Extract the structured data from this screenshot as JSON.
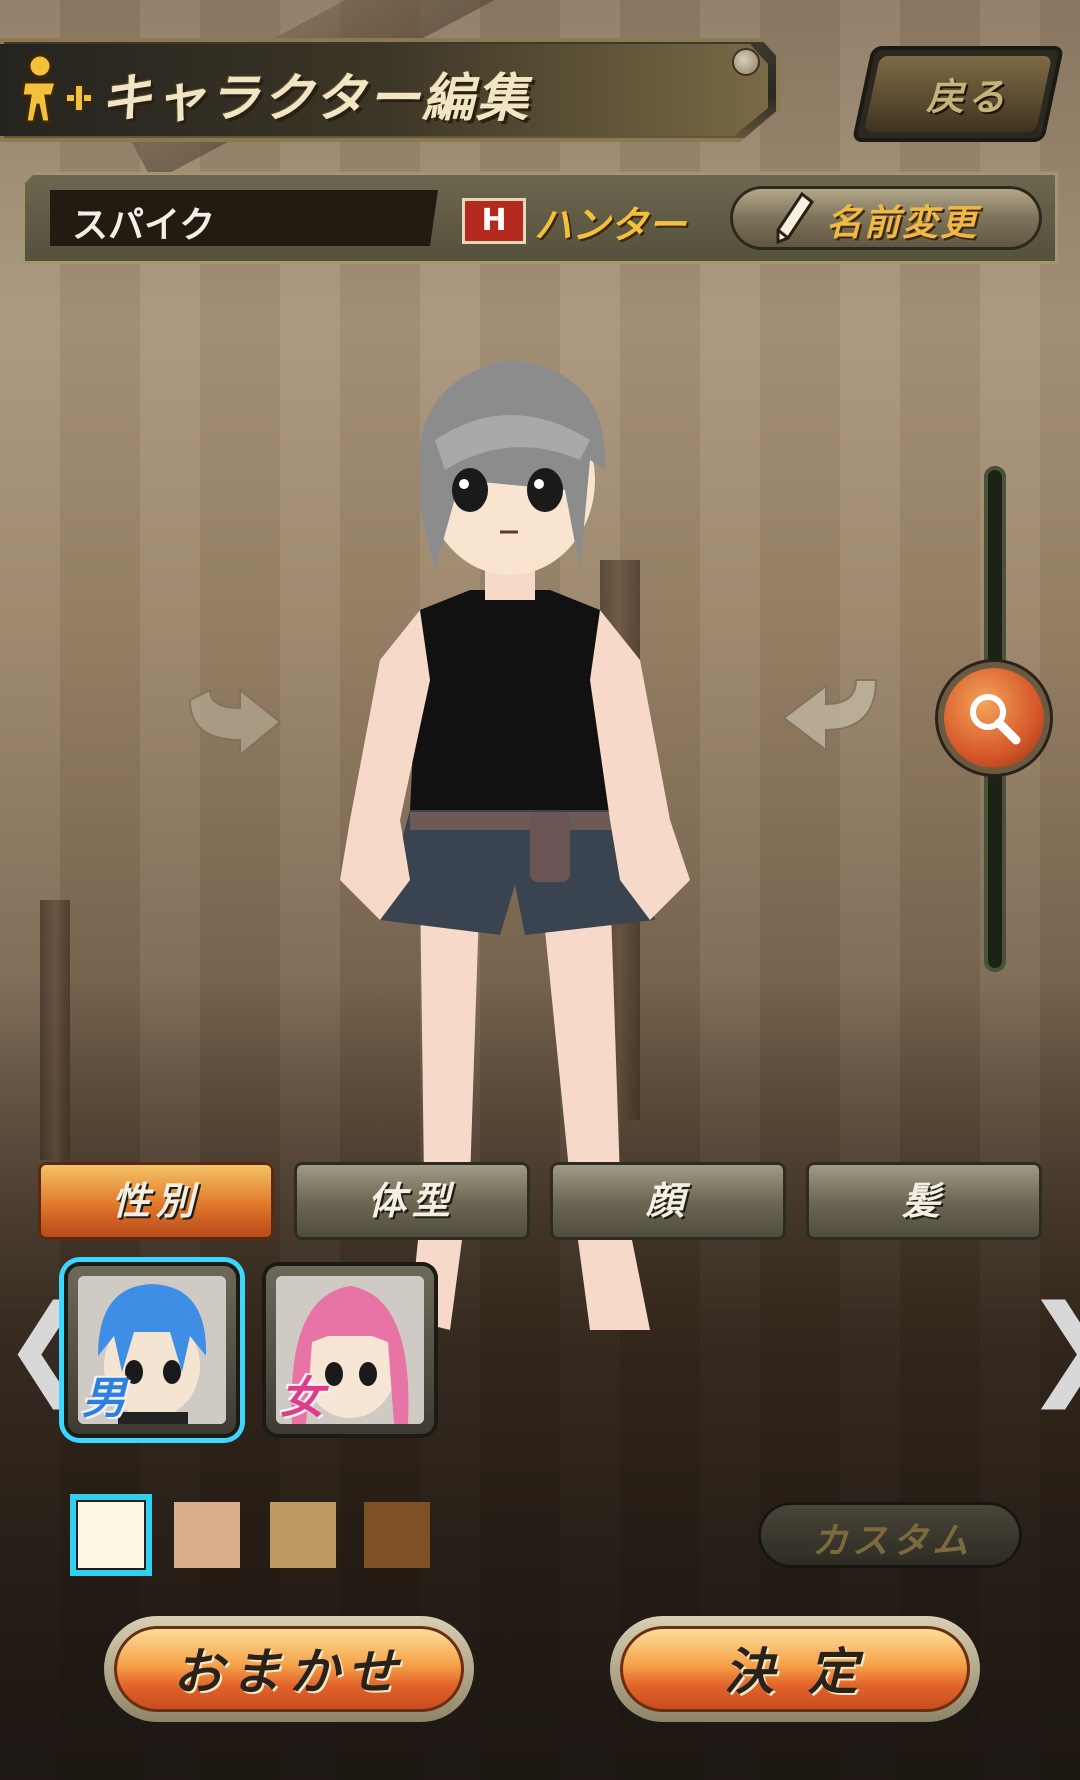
{
  "header": {
    "title": "キャラクター編集",
    "title_icon": "add-person-icon",
    "back_label": "戻る"
  },
  "character_info": {
    "name": "スパイク",
    "class_badge": "H",
    "class_name": "ハンター",
    "rename_label": "名前変更",
    "rename_icon": "pencil-icon"
  },
  "view_controls": {
    "rotate_left_icon": "rotate-left-icon",
    "rotate_right_icon": "rotate-right-icon",
    "zoom_icon": "magnifier-icon"
  },
  "tabs": [
    {
      "label": "性別",
      "active": true
    },
    {
      "label": "体型",
      "active": false
    },
    {
      "label": "顔",
      "active": false
    },
    {
      "label": "髪",
      "active": false
    }
  ],
  "gender_options": [
    {
      "label": "男",
      "selected": true
    },
    {
      "label": "女",
      "selected": false
    }
  ],
  "nav": {
    "prev": "❮",
    "next": "❯"
  },
  "skin_colors": [
    "#fff8e4",
    "#d8ae8c",
    "#bf9963",
    "#7d5123"
  ],
  "selected_skin_index": 0,
  "custom_label": "カスタム",
  "footer": {
    "random_label": "おまかせ",
    "confirm_label": "決 定"
  },
  "colors": {
    "accent_orange": "#e0782a",
    "selection_cyan": "#3cd7ff",
    "class_red": "#b42a1e",
    "gold_text": "#f3c23a"
  }
}
